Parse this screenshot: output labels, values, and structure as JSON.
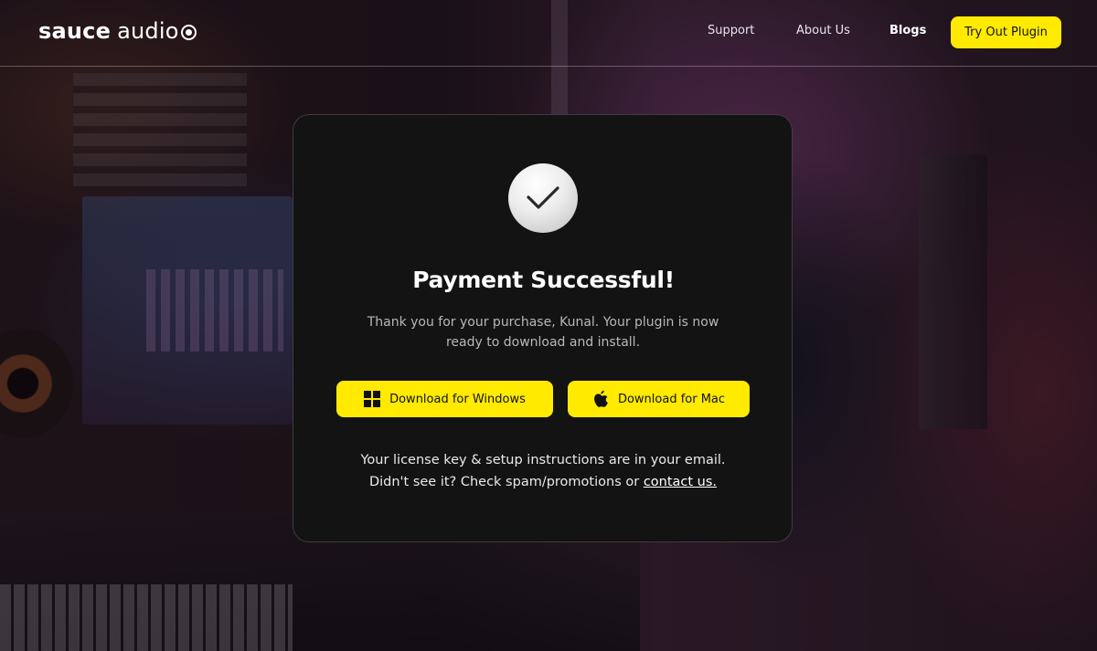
{
  "brand": {
    "logo_bold": "sauce",
    "logo_light": "audio",
    "accent_color": "#ffea00"
  },
  "nav": {
    "items": [
      {
        "label": "Support"
      },
      {
        "label": "About Us"
      },
      {
        "label": "Blogs"
      }
    ],
    "cta_label": "Try Out Plugin"
  },
  "card": {
    "icon": "check-icon",
    "title": "Payment Successful!",
    "subtitle": "Thank you for your purchase, Kunal. Your plugin is now ready to download and install.",
    "buttons": [
      {
        "label": "Download for Windows",
        "icon": "windows-icon"
      },
      {
        "label": "Download for Mac",
        "icon": "apple-icon"
      }
    ],
    "note_text": "Your license key & setup instructions are in your email. Didn't see it? Check spam/promotions or ",
    "note_link": "contact us."
  }
}
